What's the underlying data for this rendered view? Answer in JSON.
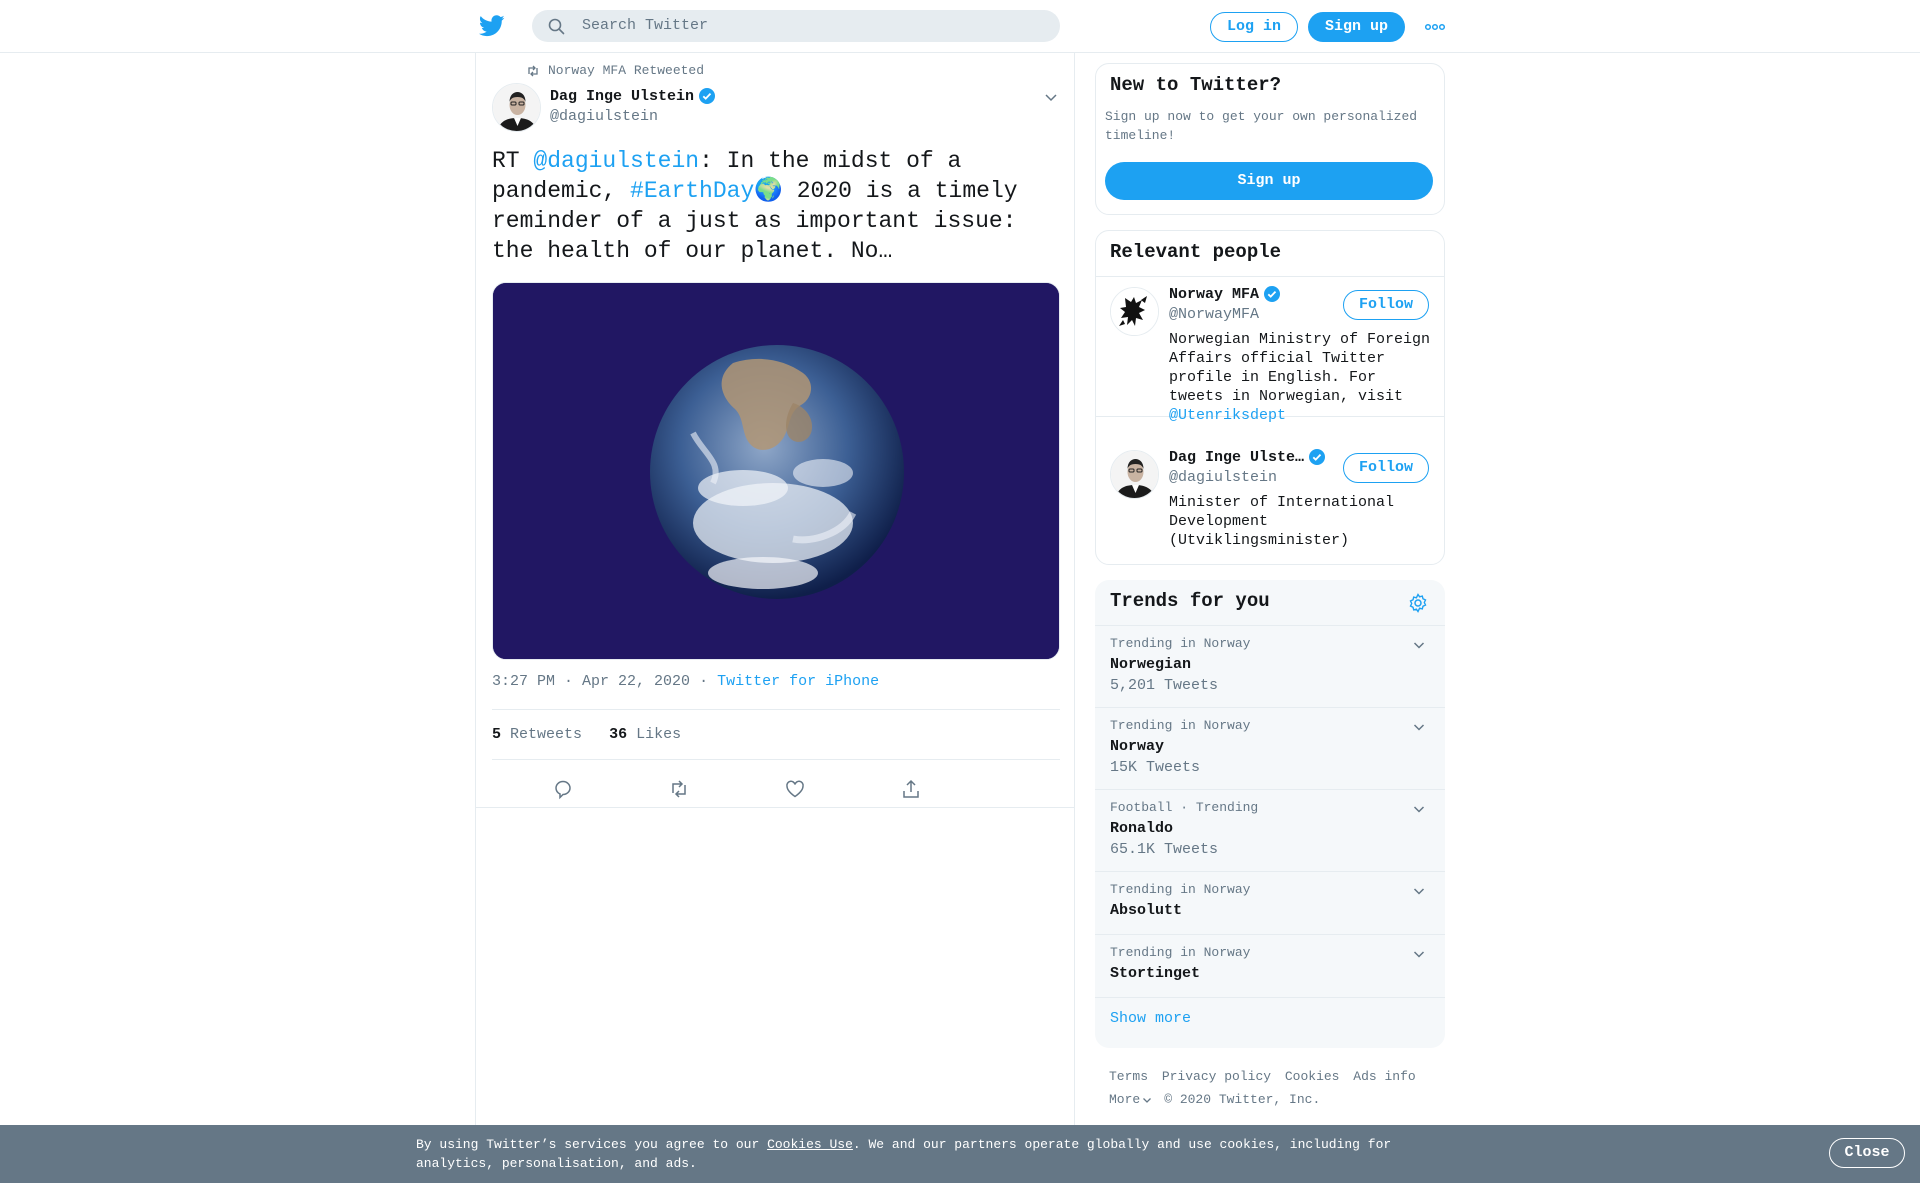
{
  "header": {
    "search_placeholder": "Search Twitter",
    "login_label": "Log in",
    "signup_label": "Sign up",
    "more_icon": "more-dots-icon"
  },
  "tweet": {
    "retweeted_by": "Norway MFA Retweeted",
    "author_name": "Dag Inge Ulstein",
    "author_handle": "@dagiulstein",
    "verified": true,
    "text_prefix": "RT ",
    "mention": "@dagiulstein",
    "text_mid": ": In the midst of a pandemic, ",
    "hashtag": "#EarthDay",
    "emoji": "🌍",
    "text_end": " 2020 is a timely reminder of a just as important issue: the health of our planet. No…",
    "time": "3:27 PM · Apr 22, 2020",
    "separator": "·",
    "source": "Twitter for iPhone",
    "retweets_count": "5",
    "retweets_label": "Retweets",
    "likes_count": "36",
    "likes_label": "Likes",
    "actions": [
      "reply-icon",
      "retweet-icon",
      "like-icon",
      "share-icon"
    ]
  },
  "sidebar": {
    "new_to_twitter": {
      "title": "New to Twitter?",
      "description": "Sign up now to get your own personalized timeline!",
      "button": "Sign up"
    },
    "relevant_people": {
      "title": "Relevant people",
      "people": [
        {
          "name": "Norway MFA",
          "handle": "@NorwayMFA",
          "bio_text": "Norwegian Ministry of Foreign Affairs official Twitter profile in English. For tweets in Norwegian, visit ",
          "bio_link": "@Utenriksdept",
          "follow": "Follow"
        },
        {
          "name": "Dag Inge Ulste…",
          "handle": "@dagiulstein",
          "bio_text": "Minister of International Development (Utviklingsminister)",
          "bio_link": "",
          "follow": "Follow"
        }
      ]
    },
    "trends": {
      "title": "Trends for you",
      "items": [
        {
          "meta": "Trending in Norway",
          "name": "Norwegian",
          "count": "5,201 Tweets"
        },
        {
          "meta": "Trending in Norway",
          "name": "Norway",
          "count": "15K Tweets"
        },
        {
          "meta": "Football · Trending",
          "name": "Ronaldo",
          "count": "65.1K Tweets"
        },
        {
          "meta": "Trending in Norway",
          "name": "Absolutt",
          "count": ""
        },
        {
          "meta": "Trending in Norway",
          "name": "Stortinget",
          "count": ""
        }
      ],
      "show_more": "Show more"
    },
    "footer": {
      "links": [
        "Terms",
        "Privacy policy",
        "Cookies",
        "Ads info"
      ],
      "more": "More",
      "copyright": "© 2020 Twitter, Inc."
    }
  },
  "cookie_banner": {
    "text_before": "By using Twitter’s services you agree to our ",
    "link": "Cookies Use",
    "text_after": ". We and our partners operate globally and use cookies, including for analytics, personalisation, and ads.",
    "close": "Close"
  },
  "colors": {
    "brand": "#1da1f2",
    "text": "#14171a",
    "secondary": "#657786",
    "border": "#e6ecf0",
    "media_bg": "#211763",
    "banner_bg": "#657786"
  }
}
